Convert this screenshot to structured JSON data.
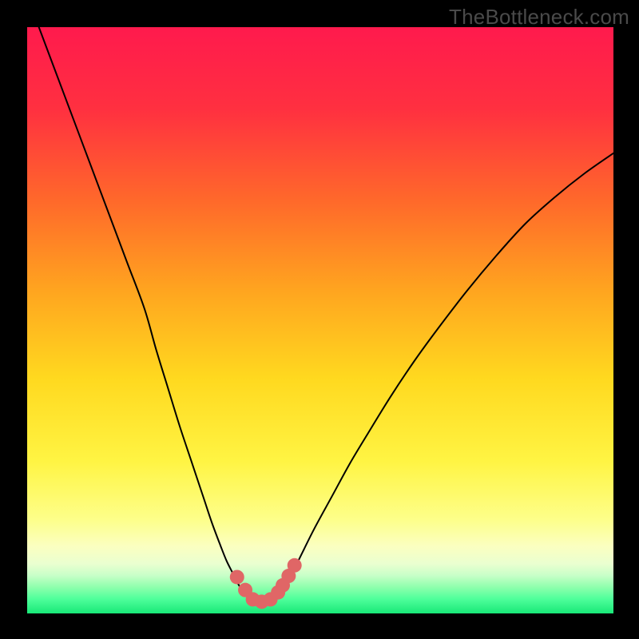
{
  "watermark": "TheBottleneck.com",
  "chart_data": {
    "type": "line",
    "title": "",
    "xlabel": "",
    "ylabel": "",
    "x_range": [
      0,
      100
    ],
    "y_range": [
      0,
      100
    ],
    "background_gradient": {
      "stops": [
        {
          "offset": 0.0,
          "color": "#ff1a4d"
        },
        {
          "offset": 0.14,
          "color": "#ff3040"
        },
        {
          "offset": 0.3,
          "color": "#ff6a2a"
        },
        {
          "offset": 0.45,
          "color": "#ffa51f"
        },
        {
          "offset": 0.6,
          "color": "#ffd91f"
        },
        {
          "offset": 0.74,
          "color": "#fff443"
        },
        {
          "offset": 0.84,
          "color": "#fdff8a"
        },
        {
          "offset": 0.885,
          "color": "#fbffc0"
        },
        {
          "offset": 0.915,
          "color": "#eaffd0"
        },
        {
          "offset": 0.935,
          "color": "#c8ffc8"
        },
        {
          "offset": 0.955,
          "color": "#8fffad"
        },
        {
          "offset": 0.975,
          "color": "#4fff9b"
        },
        {
          "offset": 1.0,
          "color": "#18e878"
        }
      ],
      "comment": "Vertical red→orange→yellow→pale→green gradient"
    },
    "series": [
      {
        "name": "left-branch",
        "color": "#000000",
        "width": 2,
        "x": [
          2.0,
          5.0,
          8.0,
          11.0,
          14.0,
          17.0,
          20.0,
          22.0,
          24.0,
          26.0,
          28.0,
          30.0,
          31.5,
          33.0,
          34.0,
          35.0,
          36.0,
          37.0,
          38.0
        ],
        "y": [
          100.0,
          92.0,
          84.0,
          76.0,
          68.0,
          60.0,
          52.0,
          45.0,
          38.5,
          32.0,
          26.0,
          20.0,
          15.5,
          11.5,
          9.0,
          7.0,
          5.0,
          3.5,
          2.5
        ]
      },
      {
        "name": "valley-floor",
        "color": "#000000",
        "width": 2,
        "x": [
          38.0,
          39.0,
          40.0,
          41.0,
          42.0
        ],
        "y": [
          2.5,
          2.0,
          2.0,
          2.0,
          2.5
        ]
      },
      {
        "name": "right-branch",
        "color": "#000000",
        "width": 2,
        "x": [
          42.0,
          43.0,
          44.0,
          45.5,
          47.0,
          49.0,
          52.0,
          55.0,
          58.0,
          62.0,
          66.0,
          70.0,
          75.0,
          80.0,
          85.0,
          90.0,
          95.0,
          100.0
        ],
        "y": [
          2.5,
          3.5,
          5.0,
          7.5,
          10.5,
          14.5,
          20.0,
          25.5,
          30.5,
          37.0,
          43.0,
          48.5,
          55.0,
          61.0,
          66.5,
          71.0,
          75.0,
          78.5
        ]
      }
    ],
    "markers": {
      "name": "valley-dots",
      "color": "#e06666",
      "radius_px": 9,
      "x": [
        35.8,
        37.2,
        38.5,
        40.0,
        41.5,
        42.8,
        43.6,
        44.6,
        45.6
      ],
      "y": [
        6.2,
        4.0,
        2.4,
        2.0,
        2.4,
        3.6,
        4.8,
        6.4,
        8.2
      ]
    }
  }
}
